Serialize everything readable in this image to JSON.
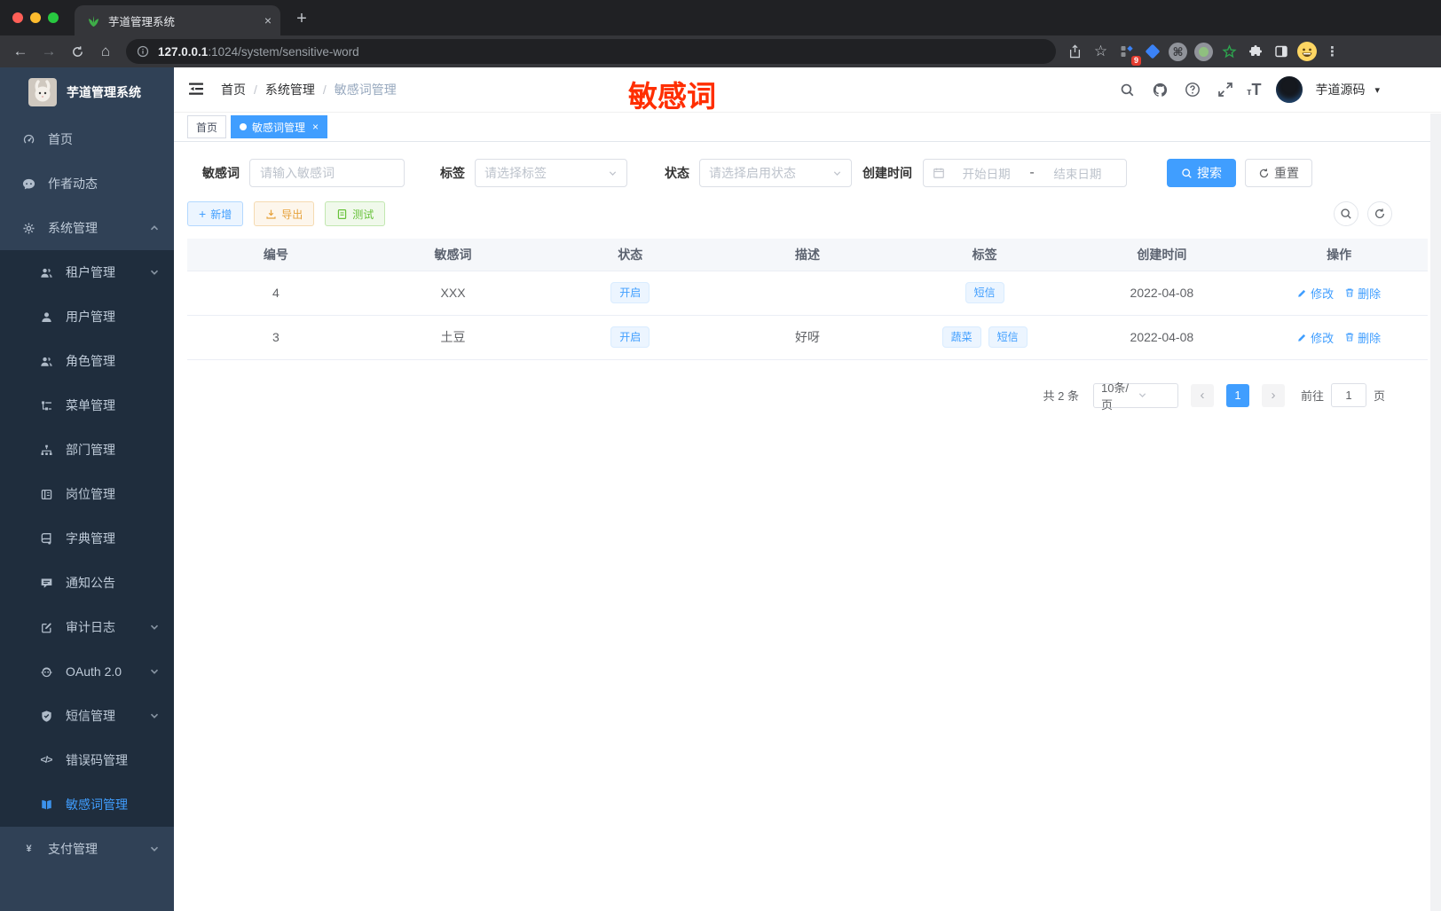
{
  "browser": {
    "tab_title": "芋道管理系统",
    "url_host": "127.0.0.1",
    "url_rest": ":1024/system/sensitive-word",
    "extension_badge": "9"
  },
  "icons": {
    "back_glyph": "←",
    "forward_glyph": "→",
    "home_glyph": "⌂",
    "star_glyph": "☆",
    "menu_dots_glyph": "⋮",
    "new_tab_glyph": "+",
    "tab_close_glyph": "×",
    "command_glyph": "⌘",
    "plus_glyph": "+",
    "close_glyph": "×",
    "prev_glyph": "‹",
    "next_glyph": "›",
    "code_glyph": "</>",
    "pay_glyph": "¥",
    "caret_glyph": "▾",
    "breadcrumb_sep": "/",
    "size_small_glyph": "т",
    "size_big_glyph": "T"
  },
  "sidebar": {
    "app_title": "芋道管理系统",
    "items": [
      {
        "label": "首页",
        "icon": "dashboard-icon",
        "level": 1
      },
      {
        "label": "作者动态",
        "icon": "author-news-icon",
        "level": 1
      },
      {
        "label": "系统管理",
        "icon": "gear-icon",
        "level": 1,
        "expandable": true,
        "expanded": true
      },
      {
        "label": "租户管理",
        "icon": "tenant-icon",
        "level": 2,
        "expandable": true
      },
      {
        "label": "用户管理",
        "icon": "user-icon",
        "level": 2
      },
      {
        "label": "角色管理",
        "icon": "role-icon",
        "level": 2
      },
      {
        "label": "菜单管理",
        "icon": "menu-tree-icon",
        "level": 2
      },
      {
        "label": "部门管理",
        "icon": "dept-icon",
        "level": 2
      },
      {
        "label": "岗位管理",
        "icon": "post-icon",
        "level": 2
      },
      {
        "label": "字典管理",
        "icon": "dict-icon",
        "level": 2
      },
      {
        "label": "通知公告",
        "icon": "notice-icon",
        "level": 2
      },
      {
        "label": "审计日志",
        "icon": "audit-log-icon",
        "level": 2,
        "expandable": true
      },
      {
        "label": "OAuth 2.0",
        "icon": "oauth-icon",
        "level": 2,
        "expandable": true
      },
      {
        "label": "短信管理",
        "icon": "sms-icon",
        "level": 2,
        "expandable": true
      },
      {
        "label": "错误码管理",
        "icon": "error-code-icon",
        "level": 2
      },
      {
        "label": "敏感词管理",
        "icon": "sensitive-word-icon",
        "level": 2,
        "active": true
      },
      {
        "label": "支付管理",
        "icon": "pay-icon",
        "level": 1,
        "expandable": true
      }
    ]
  },
  "navbar": {
    "breadcrumb": [
      "首页",
      "系统管理",
      "敏感词管理"
    ],
    "username": "芋道源码"
  },
  "annotation": {
    "text": "敏感词",
    "color": "#ff2e00"
  },
  "tags_view": [
    {
      "label": "首页",
      "active": false,
      "closable": false
    },
    {
      "label": "敏感词管理",
      "active": true,
      "closable": true
    }
  ],
  "filters": {
    "keyword_label": "敏感词",
    "keyword_placeholder": "请输入敏感词",
    "tag_label": "标签",
    "tag_placeholder": "请选择标签",
    "status_label": "状态",
    "status_placeholder": "请选择启用状态",
    "time_label": "创建时间",
    "time_start_placeholder": "开始日期",
    "time_separator": "-",
    "time_end_placeholder": "结束日期",
    "search_label": "搜索",
    "reset_label": "重置"
  },
  "toolbar": {
    "add_label": "新增",
    "export_label": "导出",
    "test_label": "测试"
  },
  "table": {
    "columns": [
      "编号",
      "敏感词",
      "状态",
      "描述",
      "标签",
      "创建时间",
      "操作"
    ],
    "rows": [
      {
        "id": "4",
        "word": "XXX",
        "status": "开启",
        "description": "",
        "tags": [
          "短信"
        ],
        "create_time": "2022-04-08"
      },
      {
        "id": "3",
        "word": "土豆",
        "status": "开启",
        "description": "好呀",
        "tags": [
          "蔬菜",
          "短信"
        ],
        "create_time": "2022-04-08"
      }
    ],
    "edit_label": "修改",
    "delete_label": "删除"
  },
  "pagination": {
    "total_text": "共 2 条",
    "page_size": "10条/页",
    "current_page": "1",
    "goto_label": "前往",
    "goto_value": "1",
    "page_unit": "页"
  },
  "colors": {
    "primary": "#409eff",
    "warning": "#e6a23c",
    "success": "#67c23a",
    "sidebar_bg": "#304156",
    "submenu_bg": "#1f2d3d",
    "annotation": "#ff2e00"
  }
}
